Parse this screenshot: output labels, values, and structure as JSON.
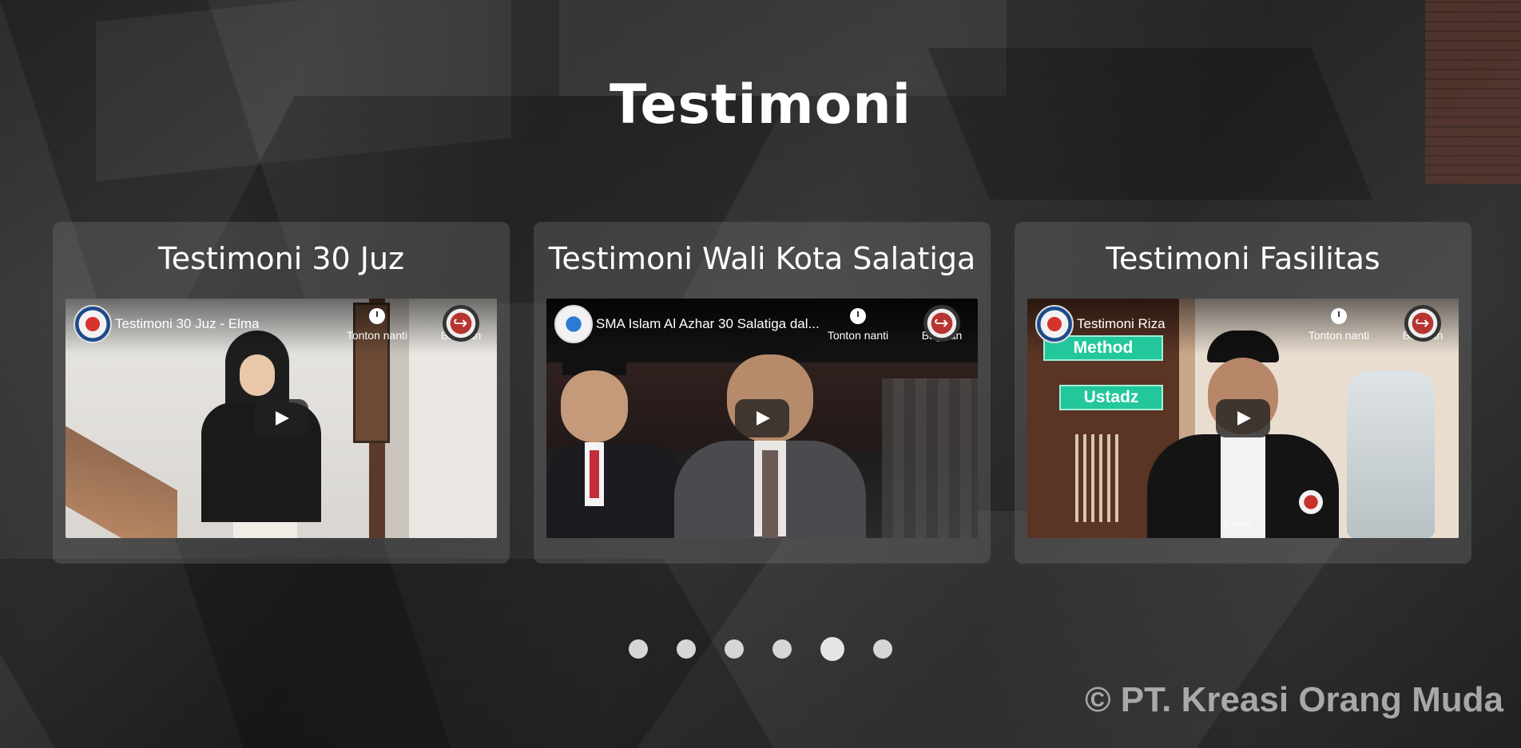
{
  "section": {
    "title": "Testimoni"
  },
  "cards": [
    {
      "title": "Testimoni 30 Juz",
      "video": {
        "title": "Testimoni 30 Juz - Elma",
        "watch_later_label": "Tonton nanti",
        "share_label": "Bagikan"
      }
    },
    {
      "title": "Testimoni Wali Kota Salatiga",
      "video": {
        "title": "SMA Islam Al Azhar 30 Salatiga dal...",
        "watch_later_label": "Tonton nanti",
        "share_label": "Bagikan"
      }
    },
    {
      "title": "Testimoni Fasilitas",
      "video": {
        "title": "Testimoni Riza",
        "watch_later_label": "Tonton nanti",
        "share_label": "Bagikan",
        "overlay_tags": [
          "Method",
          "Ustadz"
        ],
        "caption": "Ustadz"
      }
    }
  ],
  "carousel": {
    "dot_count": 6,
    "active_index": 4
  },
  "footer": {
    "copyright": "© PT. Kreasi Orang Muda"
  }
}
